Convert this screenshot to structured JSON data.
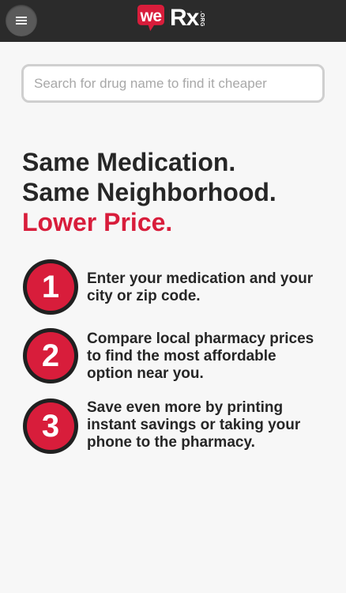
{
  "header": {
    "menu_icon": "hamburger-menu-icon",
    "logo": {
      "we": "we",
      "rx": "Rx",
      "org": ".ORG",
      "brand_color": "#d81d3b"
    }
  },
  "search": {
    "placeholder": "Search for drug name to find it cheaper",
    "value": ""
  },
  "headline": {
    "line1": "Same Medication.",
    "line2": "Same Neighborhood.",
    "line3": "Lower Price."
  },
  "steps": [
    {
      "number": "1",
      "lines": [
        "Enter your medication and your",
        "city or zip code."
      ]
    },
    {
      "number": "2",
      "lines": [
        "Compare local pharmacy prices",
        "to find the most affordable",
        "option near you."
      ]
    },
    {
      "number": "3",
      "lines": [
        "Save even more by printing",
        "instant savings or taking your",
        "phone to the pharmacy."
      ]
    }
  ],
  "colors": {
    "accent": "#d81d3b",
    "header_bg": "#2b2b2b",
    "page_bg": "#f7f7f7"
  }
}
